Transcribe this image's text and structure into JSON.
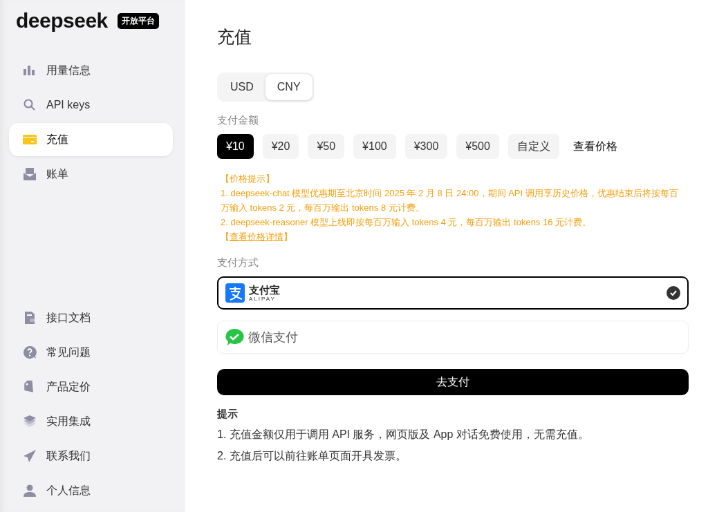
{
  "sidebar": {
    "logo": "deepseek",
    "badge": "开放平台",
    "top_items": [
      {
        "label": "用量信息",
        "selected": false
      },
      {
        "label": "API keys",
        "selected": false
      },
      {
        "label": "充值",
        "selected": true
      },
      {
        "label": "账单",
        "selected": false
      }
    ],
    "bottom_items": [
      {
        "label": "接口文档"
      },
      {
        "label": "常见问题"
      },
      {
        "label": "产品定价"
      },
      {
        "label": "实用集成"
      },
      {
        "label": "联系我们"
      },
      {
        "label": "个人信息"
      }
    ]
  },
  "page_title": "充值",
  "currency_tabs": [
    {
      "label": "USD",
      "selected": false
    },
    {
      "label": "CNY",
      "selected": true
    }
  ],
  "amount_label": "支付金额",
  "amounts": [
    {
      "label": "¥10",
      "selected": true
    },
    {
      "label": "¥20",
      "selected": false
    },
    {
      "label": "¥50",
      "selected": false
    },
    {
      "label": "¥100",
      "selected": false
    },
    {
      "label": "¥300",
      "selected": false
    },
    {
      "label": "¥500",
      "selected": false
    },
    {
      "label": "自定义",
      "selected": false
    }
  ],
  "pricing_link": "查看价格",
  "notice": {
    "title": "【价格提示】",
    "lines": [
      "1. deepseek-chat 模型优惠期至北京时间 2025 年 2 月 8 日 24:00，期间 API 调用享历史价格，优惠结束后将按每百万输入 tokens 2 元，每百万输出 tokens 8 元计费。",
      "2. deepseek-reasoner 模型上线即按每百万输入 tokens 4 元，每百万输出 tokens 16 元计费。"
    ],
    "bracket_open": "【",
    "link": "查看价格详情",
    "bracket_close": "】"
  },
  "method_label": "支付方式",
  "methods": [
    {
      "kind": "alipay",
      "label": "支付宝",
      "sublabel": "ALIPAY",
      "selected": true
    },
    {
      "kind": "wechat",
      "label": "微信支付",
      "selected": false
    }
  ],
  "pay_button": "去支付",
  "tips": {
    "title": "提示",
    "lines": [
      "1. 充值金额仅用于调用 API 服务，网页版及 App 对话免费使用，无需充值。",
      "2. 充值后可以前往账单页面开具发票。"
    ]
  }
}
